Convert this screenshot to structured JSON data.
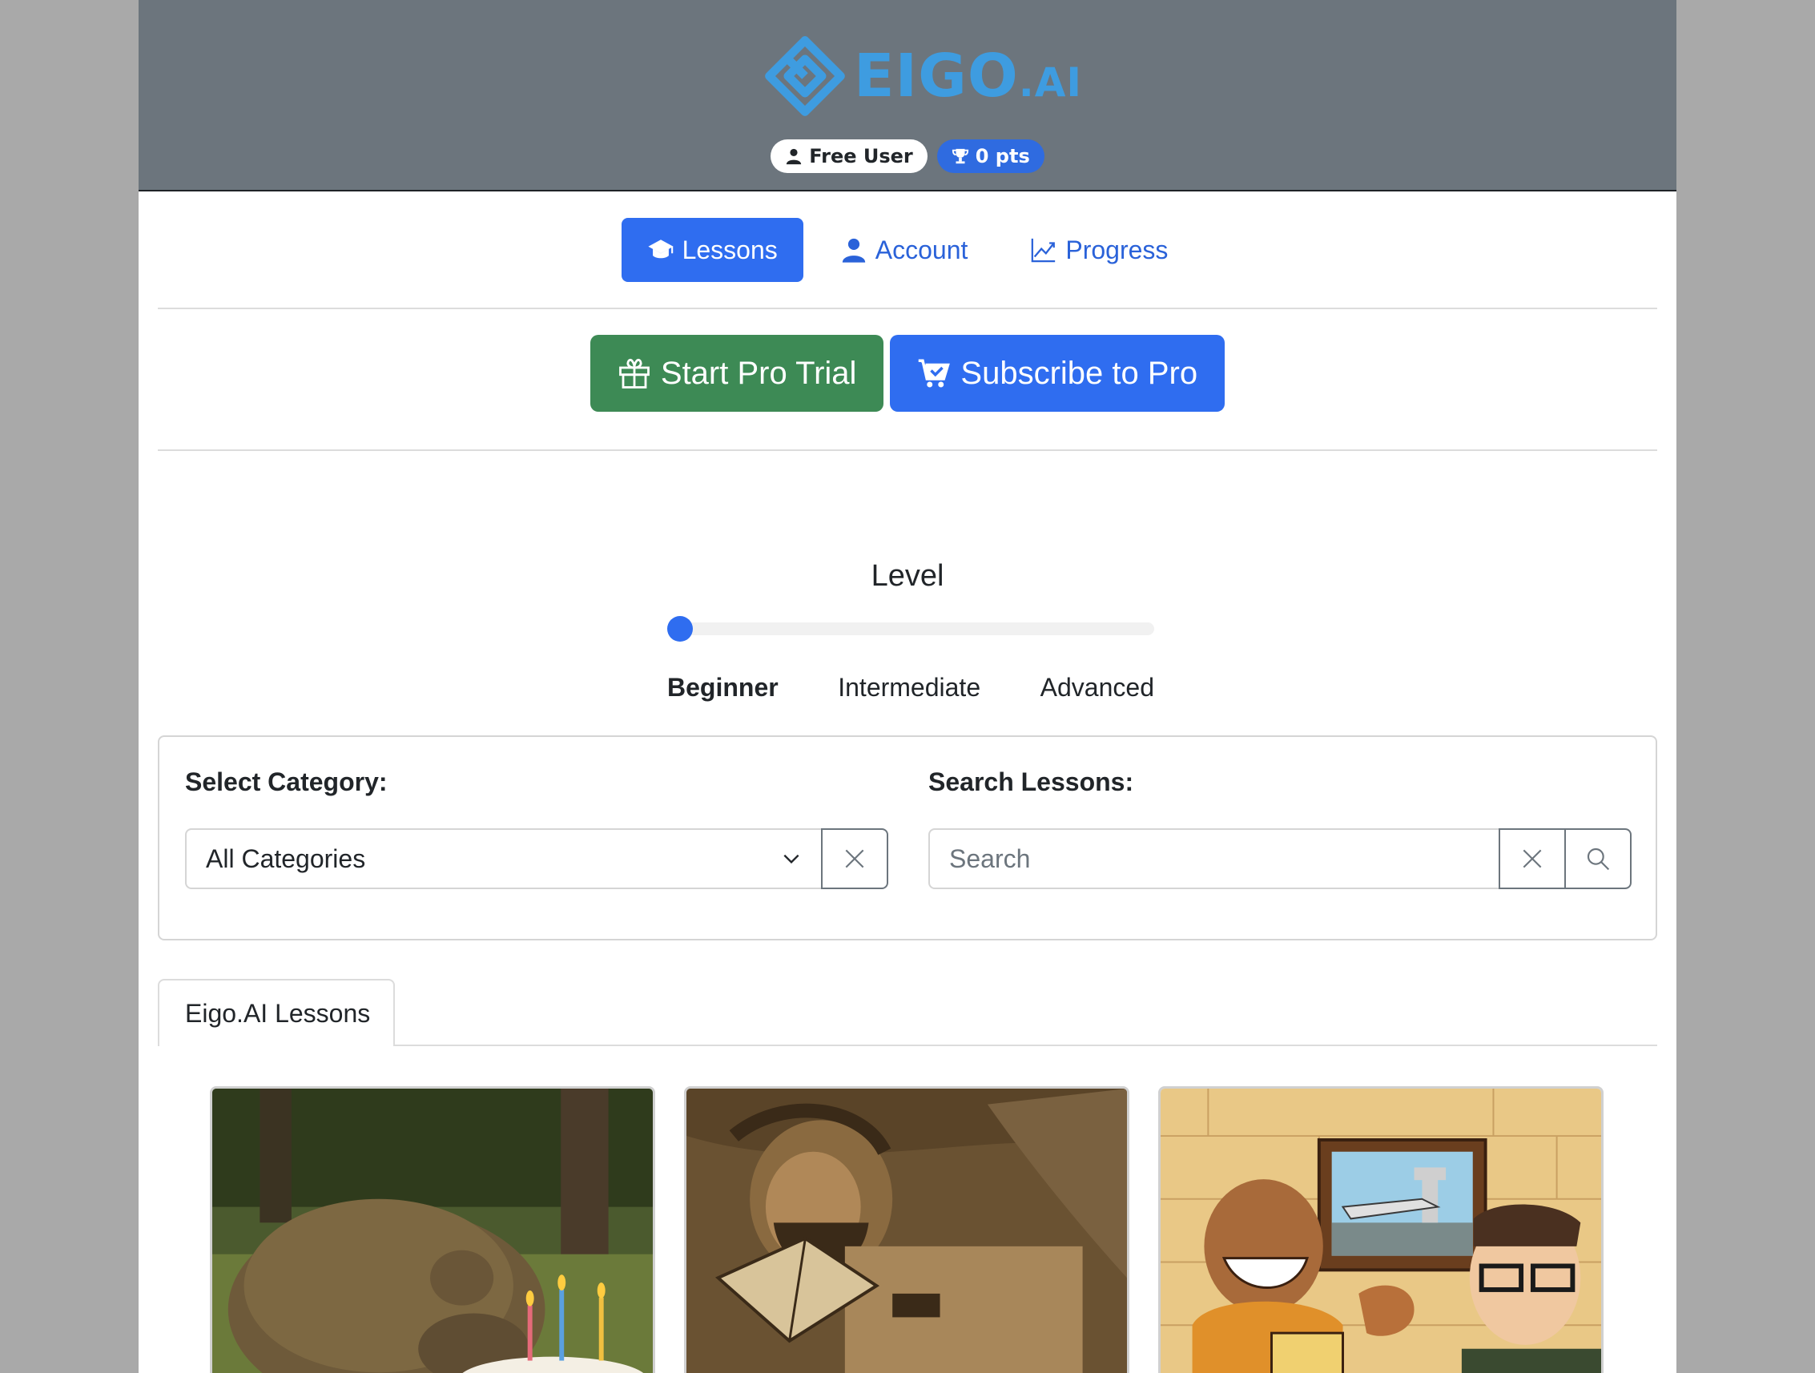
{
  "header": {
    "logo_main": "EIGO",
    "logo_suffix": ".AI",
    "user_badge": "Free User",
    "points_badge": "0 pts"
  },
  "nav": {
    "items": [
      {
        "label": "Lessons",
        "icon": "graduation-cap-icon",
        "active": true
      },
      {
        "label": "Account",
        "icon": "person-icon",
        "active": false
      },
      {
        "label": "Progress",
        "icon": "line-chart-icon",
        "active": false
      }
    ]
  },
  "cta": {
    "trial_label": "Start Pro Trial",
    "subscribe_label": "Subscribe to Pro"
  },
  "level": {
    "title": "Level",
    "options": [
      "Beginner",
      "Intermediate",
      "Advanced"
    ],
    "selected": "Beginner",
    "slider_value": 0
  },
  "filters": {
    "category_label": "Select Category:",
    "category_value": "All Categories",
    "search_label": "Search Lessons:",
    "search_placeholder": "Search"
  },
  "tabs": {
    "active_label": "Eigo.AI Lessons"
  },
  "colors": {
    "header_bg": "#6c757d",
    "brand_blue": "#3e9ce0",
    "primary": "#2f6df0",
    "success": "#3d8a55"
  }
}
